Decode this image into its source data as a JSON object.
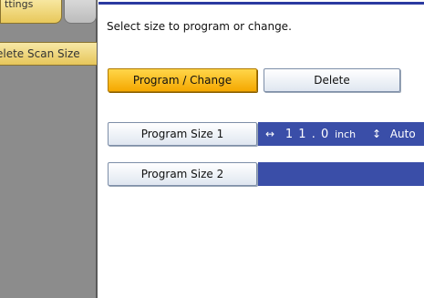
{
  "tabs": {
    "settings_label": "ttings"
  },
  "sidebar": {
    "item_label": "elete Scan Size"
  },
  "main": {
    "instruction": "Select size to program or change.",
    "program_change_label": "Program / Change",
    "delete_label": "Delete",
    "sizes": [
      {
        "label": "Program Size 1",
        "width_arrow": "↔",
        "width_value": "1 1 . 0",
        "width_unit": "inch",
        "height_arrow": "↕",
        "height_value": "Auto"
      },
      {
        "label": "Program Size 2"
      }
    ]
  },
  "colors": {
    "active_button": "#f5a800",
    "value_bar": "#3a4ea8",
    "panel": "#8c8c8c",
    "tab": "#e8c85a"
  }
}
